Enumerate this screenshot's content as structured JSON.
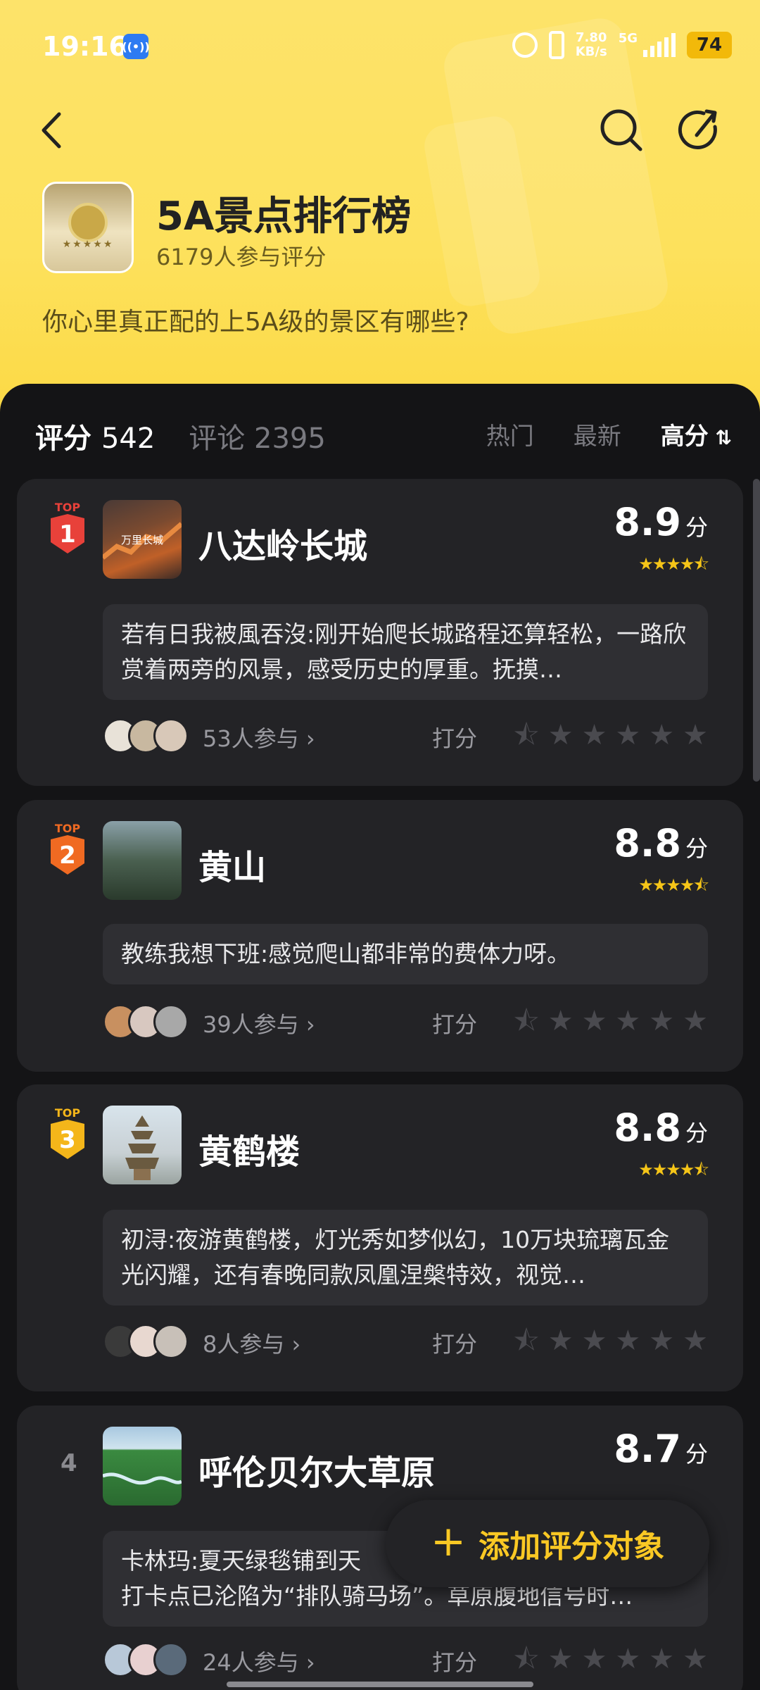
{
  "status_bar": {
    "time": "19:16",
    "net_speed": "7.80",
    "net_unit": "KB/s",
    "network": "5G",
    "battery": "74"
  },
  "header": {
    "title": "5A景点排行榜",
    "participants": "6179人参与评分",
    "question": "你心里真正配的上5A级的景区有哪些?"
  },
  "tabs": {
    "rating_label": "评分",
    "rating_count": "542",
    "comment_label": "评论",
    "comment_count": "2395"
  },
  "sort": {
    "hot": "热门",
    "latest": "最新",
    "high": "高分",
    "active": "high"
  },
  "items": [
    {
      "rank": "1",
      "rank_label": "TOP",
      "name": "八达岭长城",
      "score": "8.9",
      "score_unit": "分",
      "thumb_caption": "万里长城",
      "comment_author": "若有日我被風吞沒:",
      "comment_text": "刚开始爬长城路程还算轻松，一路欣赏着两旁的风景，感受历史的厚重。抚摸…",
      "participants": "53人参与",
      "rate_label": "打分"
    },
    {
      "rank": "2",
      "rank_label": "TOP",
      "name": "黄山",
      "score": "8.8",
      "score_unit": "分",
      "comment_author": "教练我想下班:",
      "comment_text": "感觉爬山都非常的费体力呀。",
      "participants": "39人参与",
      "rate_label": "打分"
    },
    {
      "rank": "3",
      "rank_label": "TOP",
      "name": "黄鹤楼",
      "score": "8.8",
      "score_unit": "分",
      "comment_author": "初浔:",
      "comment_text": "夜游黄鹤楼，灯光秀如梦似幻，10万块琉璃瓦金光闪耀，还有春晚同款凤凰涅槃特效，视觉…",
      "participants": "8人参与",
      "rate_label": "打分"
    },
    {
      "rank": "4",
      "name": "呼伦贝尔大草原",
      "score": "8.7",
      "score_unit": "分",
      "comment_author": "卡林玛:",
      "comment_text": "夏天绿毯铺到天",
      "comment_text_2": "打卡点已沦陷为“排队骑马场”。草原腹地信号时…",
      "participants": "24人参与",
      "rate_label": "打分"
    }
  ],
  "add_button": {
    "label": "添加评分对象"
  },
  "colors": {
    "header_bg": "#fde15c",
    "accent": "#f9c824",
    "card_bg": "#232326",
    "page_bg": "#141416",
    "rank1": "#e8413a",
    "rank2": "#f06a22",
    "rank3": "#f4b61a"
  }
}
